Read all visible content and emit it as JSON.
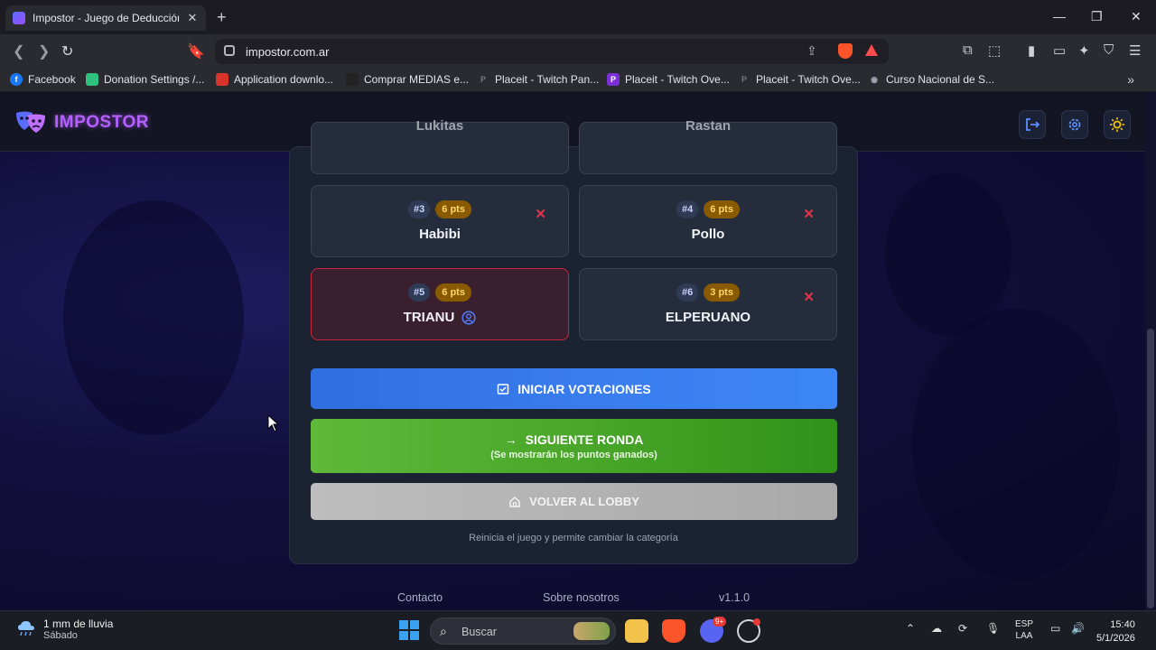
{
  "browser": {
    "tab_title": "Impostor - Juego de Deducción Social",
    "url": "impostor.com.ar",
    "bookmarks": [
      {
        "label": "Facebook",
        "color": "#1877f2"
      },
      {
        "label": "Donation Settings /...",
        "color": "#2ec27e"
      },
      {
        "label": "Application downlo...",
        "color": "#d9342b"
      },
      {
        "label": "Comprar MEDIAS e...",
        "color": "#222222"
      },
      {
        "label": "Placeit - Twitch Pan...",
        "color": "#444444"
      },
      {
        "label": "Placeit - Twitch Ove...",
        "color": "#7b2fd6"
      },
      {
        "label": "Placeit - Twitch Ove...",
        "color": "#444444"
      },
      {
        "label": "Curso Nacional de S...",
        "color": "#5a6a9a"
      }
    ]
  },
  "app": {
    "logo": "IMPOSTOR",
    "header_icons": [
      "logout-icon",
      "gear-icon",
      "sun-icon"
    ],
    "players_partial": [
      "Lukitas",
      "Rastan"
    ],
    "players": [
      {
        "num": "#3",
        "pts": "6 pts",
        "name": "Habibi",
        "removable": true,
        "is_me": false
      },
      {
        "num": "#4",
        "pts": "6 pts",
        "name": "Pollo",
        "removable": true,
        "is_me": false
      },
      {
        "num": "#5",
        "pts": "6 pts",
        "name": "TRIANU",
        "removable": false,
        "is_me": true
      },
      {
        "num": "#6",
        "pts": "3 pts",
        "name": "ELPERUANO",
        "removable": true,
        "is_me": false
      }
    ],
    "remove_symbol": "✕",
    "buttons": {
      "vote": "INICIAR VOTACIONES",
      "next": "SIGUIENTE RONDA",
      "next_sub": "(Se mostrarán los puntos ganados)",
      "lobby": "VOLVER AL LOBBY"
    },
    "hint": "Reinicia el juego y permite cambiar la categoría",
    "footer": {
      "contact": "Contacto",
      "about": "Sobre nosotros",
      "version": "v1.1.0"
    }
  },
  "taskbar": {
    "weather_line1": "1 mm de lluvia",
    "weather_line2": "Sábado",
    "search_placeholder": "Buscar",
    "lang_line1": "ESP",
    "lang_line2": "LAA",
    "time": "15:40",
    "date": "5/1/2026",
    "discord_badge": "9+"
  }
}
